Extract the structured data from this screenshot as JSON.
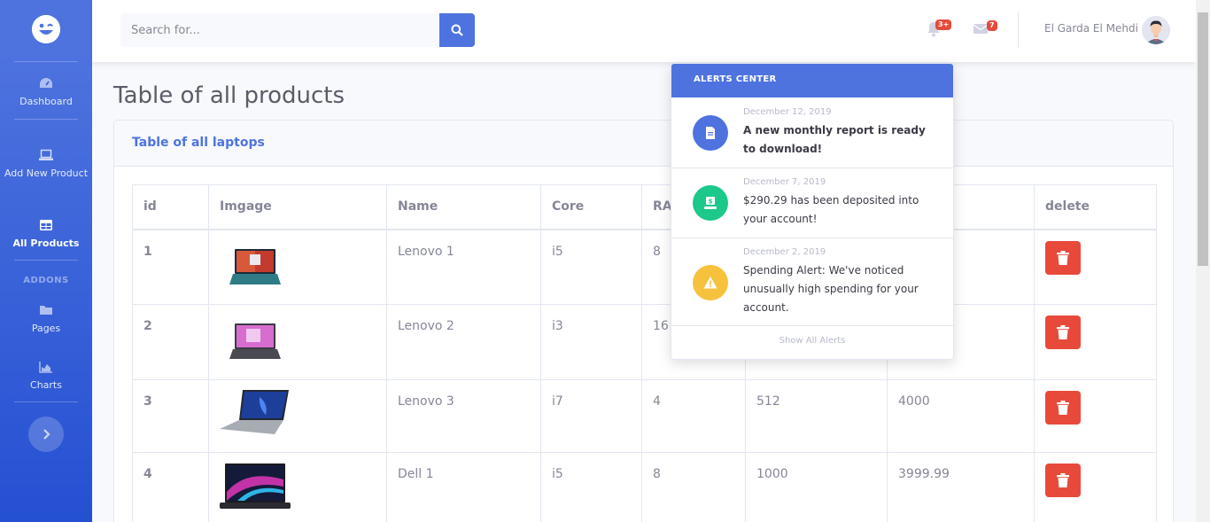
{
  "sidebar": {
    "brand_icon": "laugh-wink-icon",
    "items": [
      {
        "label": "Dashboard",
        "icon": "tachometer-icon"
      },
      {
        "label": "Add New Product",
        "icon": "laptop-icon"
      },
      {
        "label": "All Products",
        "icon": "table-icon"
      },
      {
        "label": "Pages",
        "icon": "folder-icon"
      },
      {
        "label": "Charts",
        "icon": "chart-area-icon"
      }
    ],
    "heading": "ADDONS",
    "toggle_icon": "chevron-right-icon"
  },
  "topbar": {
    "search_placeholder": "Search for...",
    "alerts_badge": "3+",
    "messages_badge": "7",
    "username": "El Garda El Mehdi"
  },
  "page": {
    "title": "Table of all products",
    "card_title": "Table of all laptops"
  },
  "table": {
    "headers": [
      "id",
      "Imgage",
      "Name",
      "Core",
      "RAM",
      "",
      "",
      "delete"
    ],
    "rows": [
      {
        "id": "1",
        "name": "Lenovo 1",
        "core": "i5",
        "ram": "8",
        "storage": "",
        "price": ""
      },
      {
        "id": "2",
        "name": "Lenovo 2",
        "core": "i3",
        "ram": "16",
        "storage": "",
        "price": ""
      },
      {
        "id": "3",
        "name": "Lenovo 3",
        "core": "i7",
        "ram": "4",
        "storage": "512",
        "price": "4000"
      },
      {
        "id": "4",
        "name": "Dell 1",
        "core": "i5",
        "ram": "8",
        "storage": "1000",
        "price": "3999.99"
      }
    ]
  },
  "alerts": {
    "header": "ALERTS CENTER",
    "items": [
      {
        "date": "December 12, 2019",
        "text": "A new monthly report is ready to download!",
        "color": "#4e73df",
        "icon": "file-icon"
      },
      {
        "date": "December 7, 2019",
        "text": "$290.29 has been deposited into your account!",
        "color": "#1cc88a",
        "icon": "donate-icon"
      },
      {
        "date": "December 2, 2019",
        "text": "Spending Alert: We've noticed unusually high spending for your account.",
        "color": "#f6c23e",
        "icon": "warning-icon"
      }
    ],
    "footer": "Show All Alerts"
  },
  "colors": {
    "primary": "#4e73df",
    "danger": "#e74a3b",
    "success": "#1cc88a",
    "warning": "#f6c23e"
  }
}
